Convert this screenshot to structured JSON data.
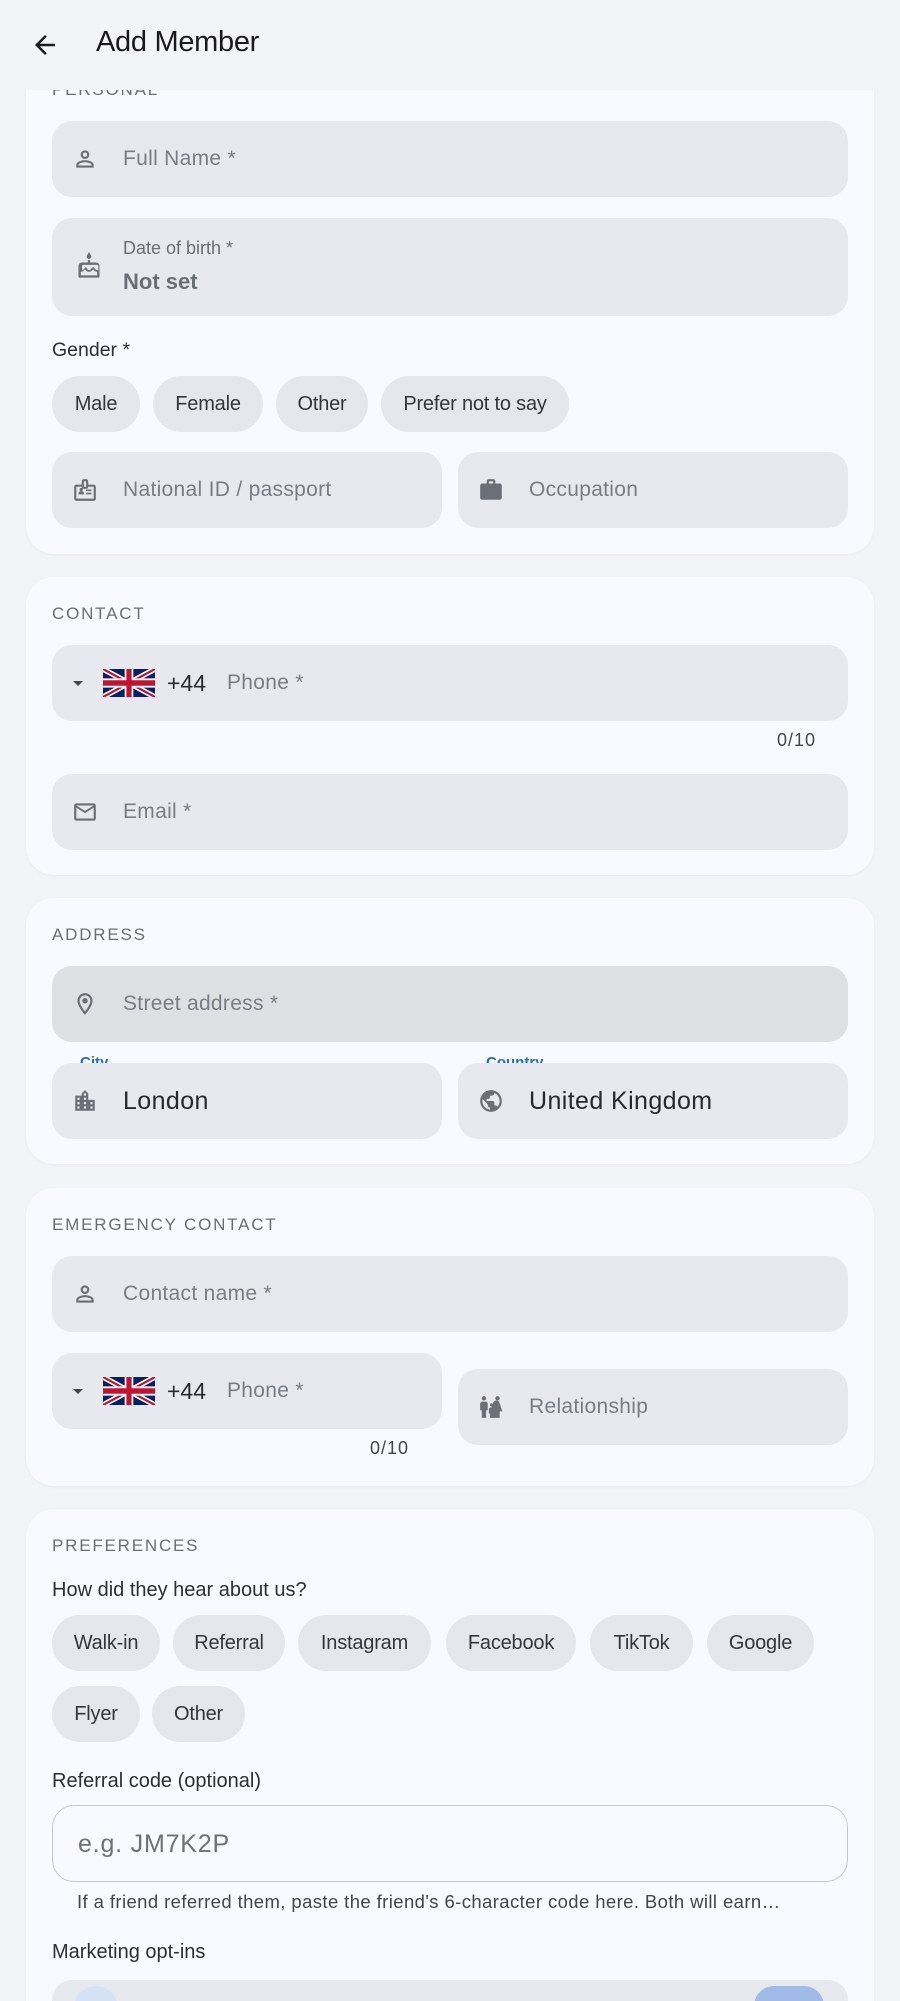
{
  "appbar": {
    "title": "Add Member",
    "back_icon": "arrow-back-icon"
  },
  "personal": {
    "section_label": "PERSONAL",
    "full_name_placeholder": "Full Name *",
    "dob_label": "Date of birth *",
    "dob_value": "Not set",
    "gender_label": "Gender *",
    "gender_options": [
      "Male",
      "Female",
      "Other",
      "Prefer not to say"
    ],
    "national_id_placeholder": "National ID / passport",
    "occupation_placeholder": "Occupation"
  },
  "contact": {
    "section_label": "CONTACT",
    "dial_code": "+44",
    "phone_placeholder": "Phone *",
    "phone_counter": "0/10",
    "email_placeholder": "Email *"
  },
  "address": {
    "section_label": "ADDRESS",
    "street_placeholder": "Street address *",
    "city_label": "City",
    "city_value": "London",
    "country_label": "Country",
    "country_value": "United Kingdom"
  },
  "emergency": {
    "section_label": "EMERGENCY CONTACT",
    "name_placeholder": "Contact name *",
    "dial_code": "+44",
    "phone_placeholder": "Phone *",
    "phone_counter": "0/10",
    "relationship_placeholder": "Relationship"
  },
  "preferences": {
    "section_label": "PREFERENCES",
    "hear_label": "How did they hear about us?",
    "hear_options": [
      "Walk-in",
      "Referral",
      "Instagram",
      "Facebook",
      "TikTok",
      "Google",
      "Flyer",
      "Other"
    ],
    "referral_label": "Referral code (optional)",
    "referral_placeholder": "e.g. JM7K2P",
    "referral_helper": "If a friend referred them, paste the friend's 6-character code here. Both will earn…",
    "marketing_label": "Marketing opt-ins"
  },
  "colors": {
    "accent": "#1f6fc6",
    "field_bg": "#e8e9ee",
    "card_bg": "#f9faff",
    "page_bg": "#f3f4f8"
  }
}
